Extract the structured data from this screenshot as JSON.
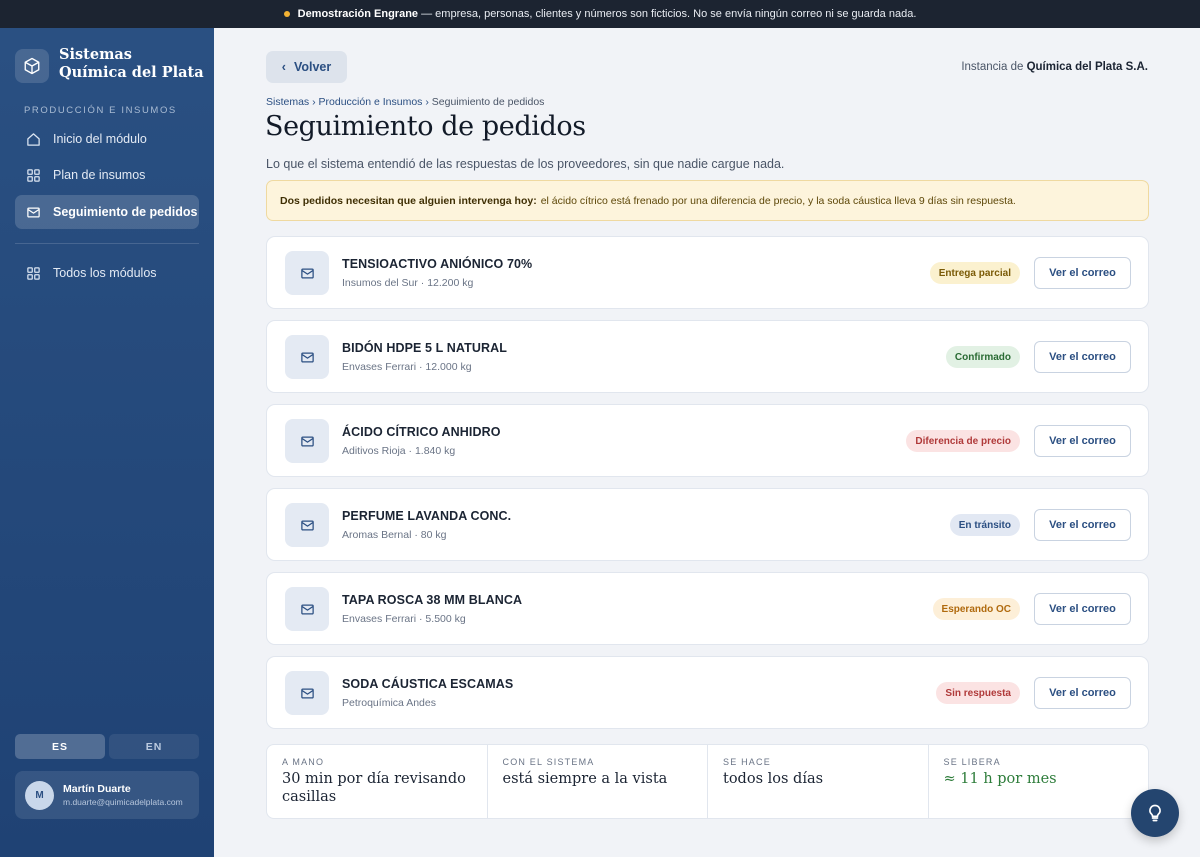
{
  "banner": {
    "title": "Demostración Engrane",
    "text": "— empresa, personas, clientes y números son ficticios. No se envía ningún correo ni se guarda nada.",
    "dot_color": "#f2b233"
  },
  "sidebar": {
    "brand_line1": "Sistemas",
    "brand_line2": "Química del Plata",
    "brand_icon": "cube-icon",
    "section": "PRODUCCIÓN E INSUMOS",
    "items": [
      {
        "label": "Inicio del módulo",
        "icon": "home-icon"
      },
      {
        "label": "Plan de insumos",
        "icon": "grid-icon"
      },
      {
        "label": "Seguimiento de pedidos",
        "icon": "mail-icon",
        "active": true
      },
      {
        "label": "Todos los módulos",
        "icon": "grid-icon"
      }
    ],
    "lang_es": "ES",
    "lang_en": "EN",
    "user_initial": "M",
    "user_name": "Martín Duarte",
    "user_email": "m.duarte@quimicadelplata.com"
  },
  "header": {
    "back_label": "Volver",
    "instance_prefix": "Instancia de",
    "instance_name": "Química del Plata S.A.",
    "breadcrumb": [
      "Sistemas",
      "Producción e Insumos",
      "Seguimiento de pedidos"
    ],
    "title": "Seguimiento de pedidos",
    "subtitle": "Lo que el sistema entendió de las respuestas de los proveedores, sin que nadie cargue nada."
  },
  "alert": {
    "bold": "Dos pedidos necesitan que alguien intervenga hoy:",
    "text": "el ácido cítrico está frenado por una diferencia de precio, y la soda cáustica lleva 9 días sin respuesta."
  },
  "orders": [
    {
      "title": "TENSIOACTIVO ANIÓNICO 70%",
      "sub": "Insumos del Sur · 12.200 kg",
      "status": "Entrega parcial",
      "badge_bg": "#fbf1cf",
      "badge_fg": "#7a5a06",
      "button": "Ver el correo"
    },
    {
      "title": "BIDÓN HDPE 5 L NATURAL",
      "sub": "Envases Ferrari · 12.000 kg",
      "status": "Confirmado",
      "badge_bg": "#e2f1e4",
      "badge_fg": "#2a6b34",
      "button": "Ver el correo"
    },
    {
      "title": "ÁCIDO CÍTRICO ANHIDRO",
      "sub": "Aditivos Rioja · 1.840 kg",
      "status": "Diferencia de precio",
      "badge_bg": "#fbe3e3",
      "badge_fg": "#b03a3a",
      "button": "Ver el correo"
    },
    {
      "title": "PERFUME LAVANDA CONC.",
      "sub": "Aromas Bernal · 80 kg",
      "status": "En tránsito",
      "badge_bg": "#e2e8f3",
      "badge_fg": "#2b4f82",
      "button": "Ver el correo"
    },
    {
      "title": "TAPA ROSCA 38 MM BLANCA",
      "sub": "Envases Ferrari · 5.500 kg",
      "status": "Esperando OC",
      "badge_bg": "#fdefd8",
      "badge_fg": "#b06a0e",
      "button": "Ver el correo"
    },
    {
      "title": "SODA CÁUSTICA ESCAMAS",
      "sub": "Petroquímica Andes",
      "status": "Sin respuesta",
      "badge_bg": "#fbe3e3",
      "badge_fg": "#b03a3a",
      "button": "Ver el correo"
    }
  ],
  "stats": [
    {
      "label": "A MANO",
      "value": "30 min por día revisando casillas"
    },
    {
      "label": "CON EL SISTEMA",
      "value": "está siempre a la vista"
    },
    {
      "label": "SE HACE",
      "value": "todos los días"
    },
    {
      "label": "SE LIBERA",
      "value": "≈ 11 h por mes",
      "highlight": true
    }
  ],
  "help_icon": "lightbulb-icon"
}
